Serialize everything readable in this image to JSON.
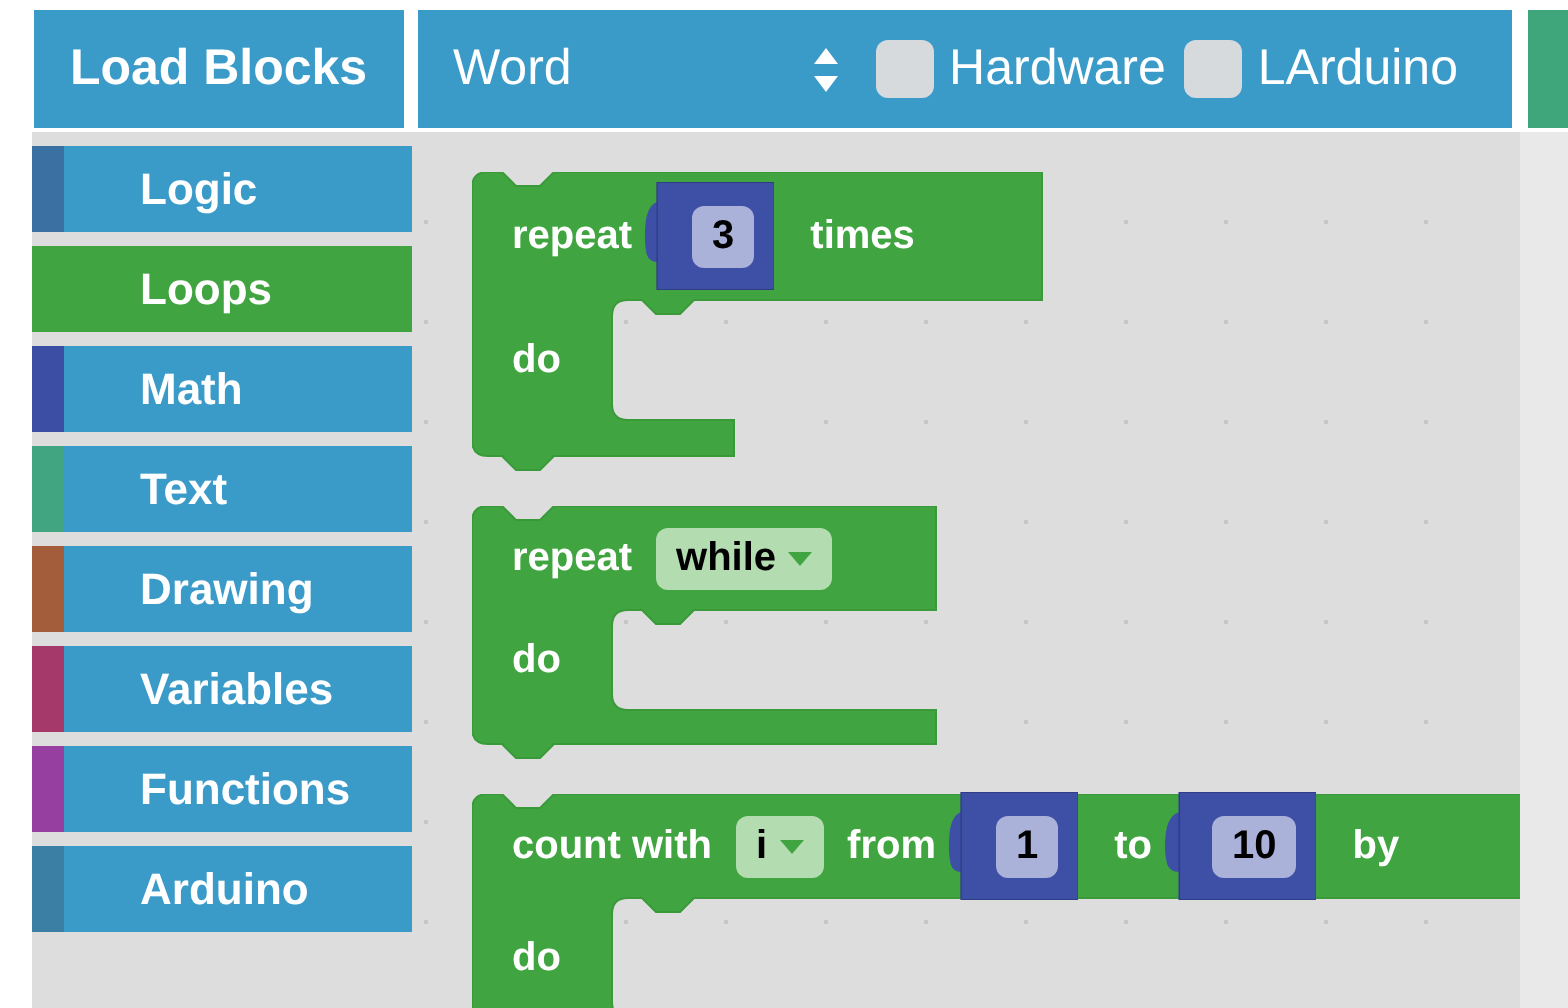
{
  "toolbar": {
    "load_button": "Load Blocks",
    "language_select": "Word",
    "checkboxes": [
      {
        "label": "Hardware",
        "checked": false
      },
      {
        "label": "LArduino",
        "checked": false
      }
    ]
  },
  "categories": [
    {
      "label": "Logic",
      "color": "#3b70a3",
      "selected": false
    },
    {
      "label": "Loops",
      "color": "#40a540",
      "selected": true
    },
    {
      "label": "Math",
      "color": "#3c4ea3",
      "selected": false
    },
    {
      "label": "Text",
      "color": "#42a582",
      "selected": false
    },
    {
      "label": "Drawing",
      "color": "#a35d3a",
      "selected": false
    },
    {
      "label": "Variables",
      "color": "#a53a6a",
      "selected": false
    },
    {
      "label": "Functions",
      "color": "#963fa0",
      "selected": false
    },
    {
      "label": "Arduino",
      "color": "#3b7fa5",
      "selected": false
    }
  ],
  "blocks": [
    {
      "header": [
        {
          "kind": "label",
          "text": "repeat"
        },
        {
          "kind": "number",
          "text": "3"
        },
        {
          "kind": "label",
          "text": "times"
        }
      ],
      "do": "do"
    },
    {
      "header": [
        {
          "kind": "label",
          "text": "repeat"
        },
        {
          "kind": "dropdown",
          "text": "while"
        }
      ],
      "do": "do"
    },
    {
      "header": [
        {
          "kind": "label",
          "text": "count with"
        },
        {
          "kind": "dropdown",
          "text": "i"
        },
        {
          "kind": "label",
          "text": "from"
        },
        {
          "kind": "number",
          "text": "1"
        },
        {
          "kind": "label",
          "text": "to"
        },
        {
          "kind": "number",
          "text": "10"
        },
        {
          "kind": "label",
          "text": "by"
        }
      ],
      "do": "do"
    }
  ]
}
